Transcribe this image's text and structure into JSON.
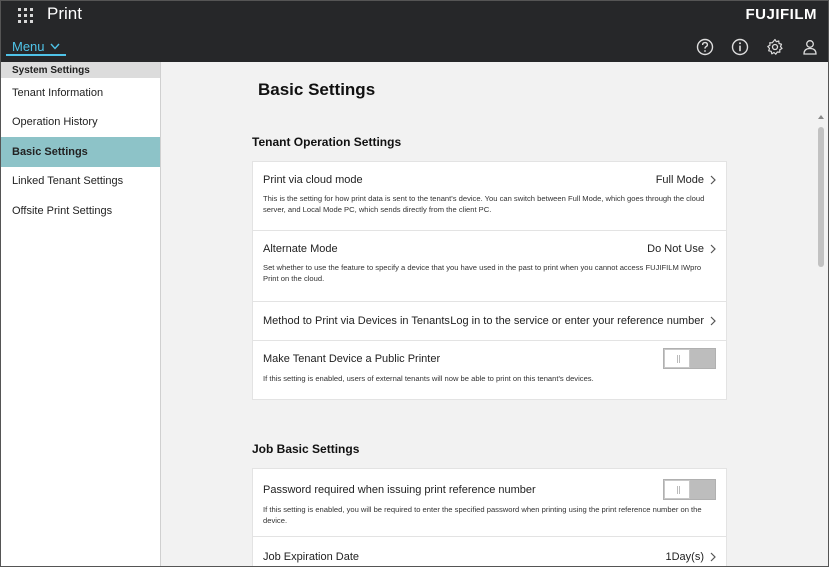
{
  "header": {
    "app_title": "Print",
    "brand": "FUJIFILM",
    "menu_label": "Menu",
    "icons": [
      "help-icon",
      "info-icon",
      "gear-icon",
      "user-icon"
    ]
  },
  "sidebar": {
    "group": "System Settings",
    "items": [
      {
        "label": "Tenant Information"
      },
      {
        "label": "Operation History"
      },
      {
        "label": "Basic Settings",
        "active": true
      },
      {
        "label": "Linked Tenant Settings"
      },
      {
        "label": "Offsite Print Settings"
      }
    ]
  },
  "main": {
    "page_title": "Basic Settings",
    "tenant_section": {
      "title": "Tenant Operation Settings",
      "rows": [
        {
          "label": "Print via cloud mode",
          "value": "Full Mode",
          "desc": "This is the setting for how print data is sent to the tenant's device. You can switch between Full Mode, which goes through the cloud server, and Local Mode PC, which sends directly from the client PC."
        },
        {
          "label": "Alternate Mode",
          "value": "Do Not Use",
          "desc": "Set whether to use the feature to specify a device that you have used in the past to print when you cannot access FUJIFILM IWpro Print on the cloud."
        },
        {
          "label": "Method to Print via Devices in Tenants",
          "value": "Log in to the service or enter your reference number"
        },
        {
          "label": "Make Tenant Device a Public Printer",
          "toggle": "off",
          "desc": "If this setting is enabled, users of external tenants will now be able to print on this tenant's devices."
        }
      ]
    },
    "job_section": {
      "title": "Job Basic Settings",
      "rows": [
        {
          "label": "Password required when issuing print reference number",
          "toggle": "off",
          "desc": "If this setting is enabled, you will be required to enter the specified password when printing using the print reference number on the device."
        },
        {
          "label": "Job Expiration Date",
          "value": "1Day(s)"
        }
      ]
    }
  }
}
